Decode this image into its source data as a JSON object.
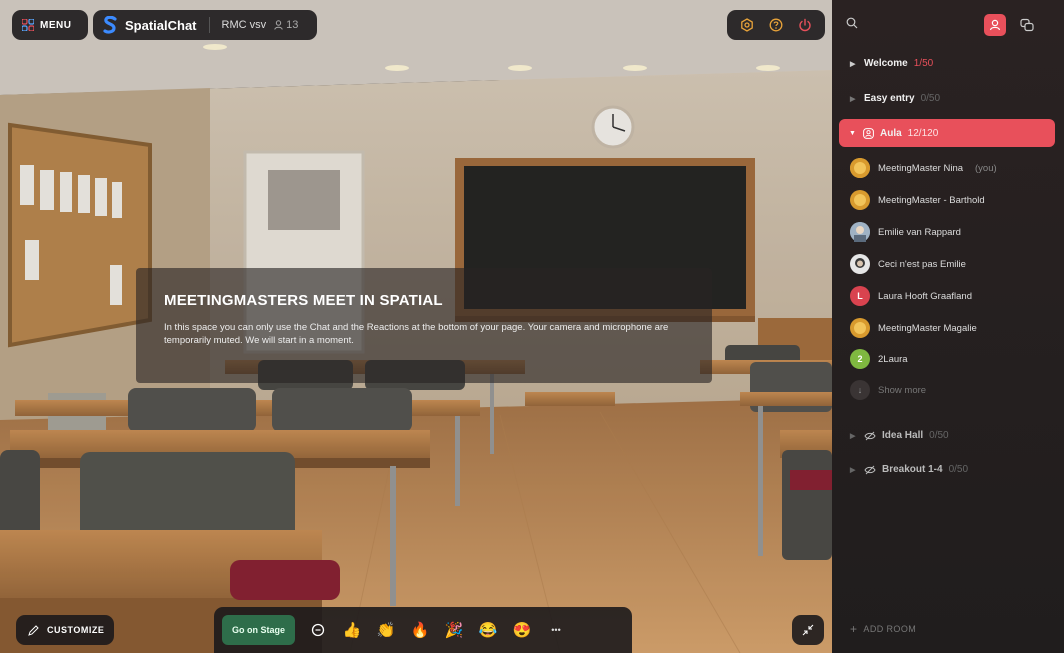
{
  "topbar": {
    "menu_label": "MENU",
    "brand": "SpatialChat",
    "room_name": "RMC vsv",
    "participant_count": "13"
  },
  "banner": {
    "title": "MEETINGMASTERS MEET IN SPATIAL",
    "text": "In this space you can only use the Chat and the Reactions at the bottom of your page. Your camera and microphone are temporarily muted. We will start in a moment."
  },
  "bottom": {
    "customize_label": "CUSTOMIZE",
    "go_on_stage_label": "Go on Stage",
    "more_label": "•••",
    "reactions": [
      "👍",
      "👏",
      "🔥",
      "🎉",
      "😂",
      "😍"
    ]
  },
  "sidebar": {
    "rooms": [
      {
        "name": "Welcome",
        "capacity": "1/50"
      },
      {
        "name": "Easy entry",
        "capacity": "0/50"
      },
      {
        "name": "Aula",
        "capacity": "12/120"
      },
      {
        "name": "Idea Hall",
        "capacity": "0/50"
      },
      {
        "name": "Breakout 1-4",
        "capacity": "0/50"
      }
    ],
    "members": [
      {
        "name": "MeetingMaster Nina",
        "suffix": "(you)"
      },
      {
        "name": "MeetingMaster - Barthold",
        "suffix": ""
      },
      {
        "name": "Emilie van Rappard",
        "suffix": ""
      },
      {
        "name": "Ceci n'est pas Emilie",
        "suffix": ""
      },
      {
        "name": "Laura Hooft Graafland",
        "suffix": "",
        "initial": "L"
      },
      {
        "name": "MeetingMaster Magalie",
        "suffix": ""
      },
      {
        "name": "2Laura",
        "suffix": "",
        "initial": "2"
      }
    ],
    "show_more": "Show more",
    "add_room": "ADD ROOM"
  },
  "colors": {
    "accent": "#e8505b",
    "stage_button": "#2e6d4a",
    "sidebar_bg": "#241f1f"
  }
}
